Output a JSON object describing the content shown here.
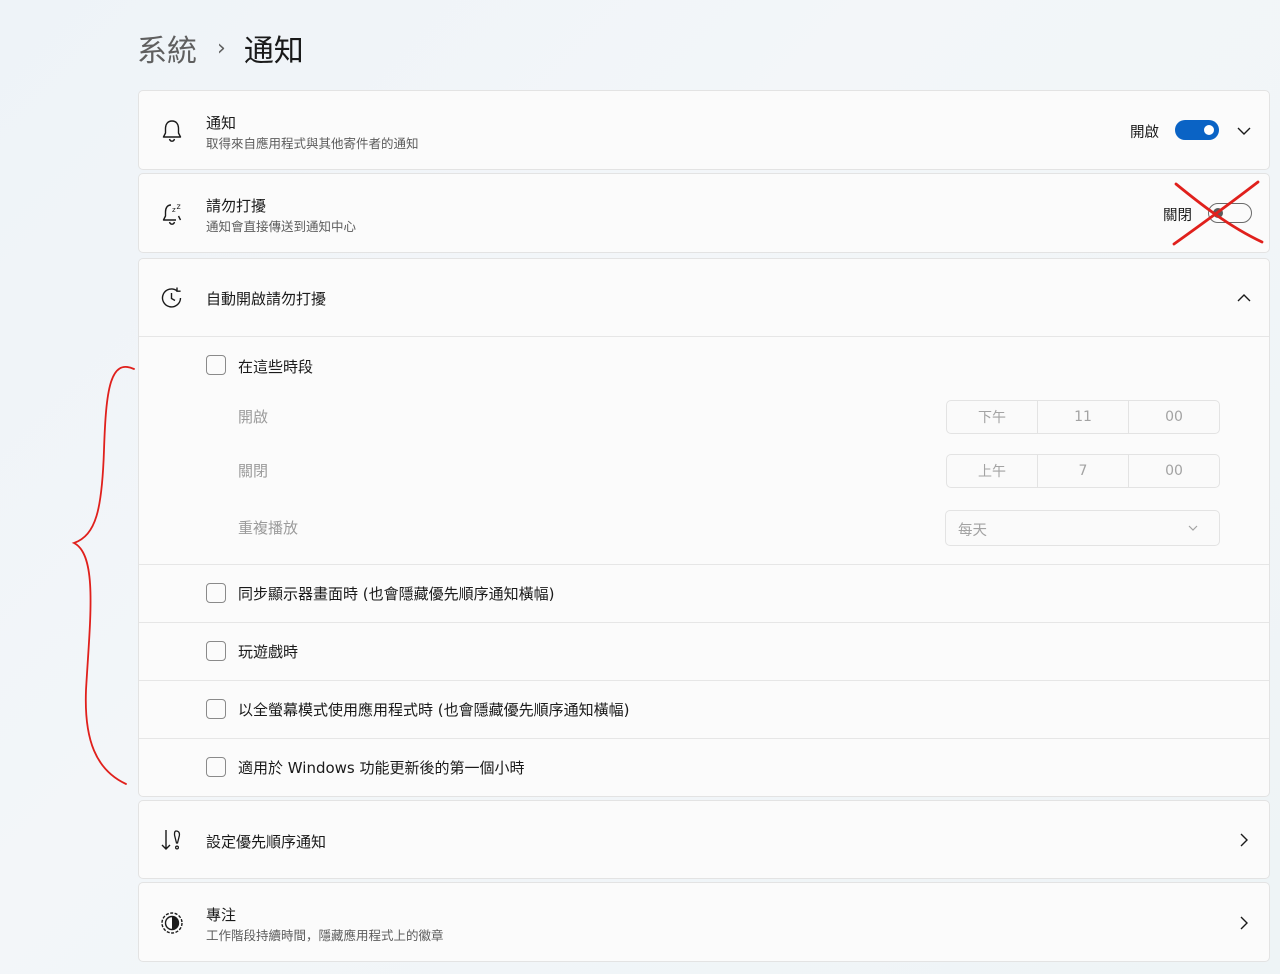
{
  "breadcrumb": {
    "parent": "系統",
    "separator": "›",
    "current": "通知"
  },
  "notifications": {
    "title": "通知",
    "subtitle": "取得來自應用程式與其他寄件者的通知",
    "state_label": "開啟",
    "state": "on"
  },
  "dnd": {
    "title": "請勿打擾",
    "subtitle": "通知會直接傳送到通知中心",
    "state_label": "關閉",
    "state": "off"
  },
  "auto_dnd": {
    "title": "自動開啟請勿打擾",
    "expanded": true,
    "during_times": {
      "label": "在這些時段",
      "checked": false,
      "on_label": "開啟",
      "on_time": {
        "period": "下午",
        "hour": "11",
        "minute": "00"
      },
      "off_label": "關閉",
      "off_time": {
        "period": "上午",
        "hour": "7",
        "minute": "00"
      },
      "repeat_label": "重複播放",
      "repeat_value": "每天"
    },
    "options": [
      {
        "label": "同步顯示器畫面時 (也會隱藏優先順序通知橫幅)",
        "checked": false
      },
      {
        "label": "玩遊戲時",
        "checked": false
      },
      {
        "label": "以全螢幕模式使用應用程式時 (也會隱藏優先順序通知橫幅)",
        "checked": false
      },
      {
        "label": "適用於 Windows 功能更新後的第一個小時",
        "checked": false
      }
    ]
  },
  "priority": {
    "title": "設定優先順序通知"
  },
  "focus": {
    "title": "專注",
    "subtitle": "工作階段持續時間，隱藏應用程式上的徽章"
  },
  "colors": {
    "accent": "#0a63c5",
    "annotation": "#e0201c"
  },
  "icons": [
    "bell-icon",
    "bell-snooze-icon",
    "clock-icon",
    "priority-icon",
    "focus-icon",
    "chevron-down-icon",
    "chevron-up-icon",
    "chevron-right-icon"
  ]
}
